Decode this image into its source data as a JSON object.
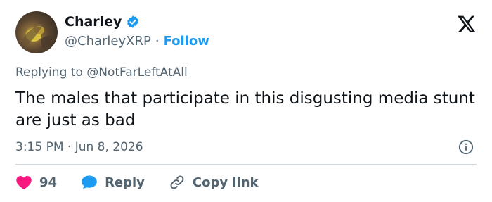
{
  "tweet": {
    "author_name": "Charley",
    "author_handle": "@CharleyXRP",
    "separator": "·",
    "follow_label": "Follow",
    "replying_prefix": "Replying to",
    "replying_to": "@NotFarLeftAtAll",
    "text": "The males that participate in this disgusting media stunt are just as bad",
    "timestamp": "3:15 PM · Jun 8, 2026"
  },
  "actions": {
    "like_count": "94",
    "reply_label": "Reply",
    "copy_link_label": "Copy link"
  },
  "icons": {
    "verified": "verified-badge-icon",
    "logo": "x-logo-icon",
    "info": "info-icon",
    "like": "heart-icon",
    "reply": "speech-bubble-icon",
    "copy": "link-icon"
  },
  "colors": {
    "accent": "#1d9bf0",
    "like": "#f91880",
    "text": "#0f1419",
    "muted": "#536471",
    "divider": "#cfd9de"
  }
}
